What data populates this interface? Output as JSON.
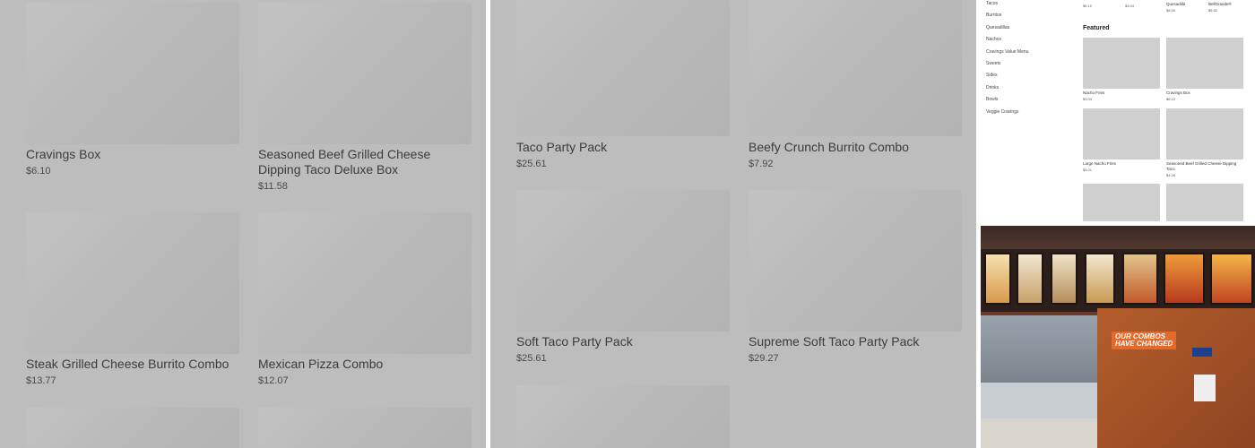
{
  "panel_a": {
    "cards": [
      {
        "title": "Cravings Box",
        "price": "$6.10"
      },
      {
        "title": "Seasoned Beef Grilled Cheese Dipping Taco Deluxe Box",
        "price": "$11.58"
      },
      {
        "title": "Steak Grilled Cheese Burrito Combo",
        "price": "$13.77"
      },
      {
        "title": "Mexican Pizza Combo",
        "price": "$12.07"
      }
    ]
  },
  "panel_b": {
    "cards": [
      {
        "title": "Taco Party Pack",
        "price": "$25.61"
      },
      {
        "title": "Beefy Crunch Burrito Combo",
        "price": "$7.92"
      },
      {
        "title": "Soft Taco Party Pack",
        "price": "$25.61"
      },
      {
        "title": "Supreme Soft Taco Party Pack",
        "price": "$29.27"
      }
    ]
  },
  "panel_c": {
    "categories": [
      "Tacos",
      "Burritos",
      "Quesadillas",
      "Nachos",
      "Cravings Value Menu",
      "Sweets",
      "Sides",
      "Drinks",
      "Bowls",
      "Veggie Cravings"
    ],
    "top_row": [
      {
        "label": "",
        "price": "$5.10"
      },
      {
        "label": "",
        "price": "$3.04"
      },
      {
        "label": "Quesadilla",
        "price": "$8.59"
      },
      {
        "label": "BellGrande®",
        "price": "$6.82"
      }
    ],
    "featured_heading": "Featured",
    "featured": [
      {
        "label": "Nacho Fries",
        "price": "$3.04"
      },
      {
        "label": "Cravings Box",
        "price": "$6.10"
      },
      {
        "label": "Large Nacho Fries",
        "price": "$4.01"
      },
      {
        "label": "Seasoned Beef Grilled Cheese Dipping Taco",
        "price": "$4.26"
      }
    ]
  },
  "panel_d": {
    "sign_line1": "OUR COMBOS",
    "sign_line2": "HAVE CHANGED"
  }
}
